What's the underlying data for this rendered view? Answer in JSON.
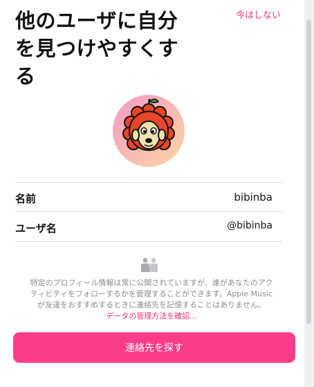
{
  "header": {
    "title_lines": [
      "他のユーザに自分",
      "を見つけやすくす",
      "る"
    ],
    "skip_label": "今はしない"
  },
  "profile": {
    "avatar_icon": "sheep-avatar-icon",
    "rows": [
      {
        "label": "名前",
        "value": "bibinba"
      },
      {
        "label": "ユーザ名",
        "value": "@bibinba"
      }
    ]
  },
  "privacy": {
    "icon": "people-handshake-icon",
    "notice_lines": [
      "特定のプロフィール情報は常に公開されていますが、誰があなたのアク",
      "ティビティをフォローするかを管理することができます。Apple Music",
      "が友達をおすすめするときに連絡先を記憶することはありません。"
    ],
    "link_label": "データの管理方法を確認..."
  },
  "actions": {
    "primary_label": "連絡先を探す"
  },
  "colors": {
    "accent": "#fa2d78",
    "button": "#fc3c8b"
  }
}
